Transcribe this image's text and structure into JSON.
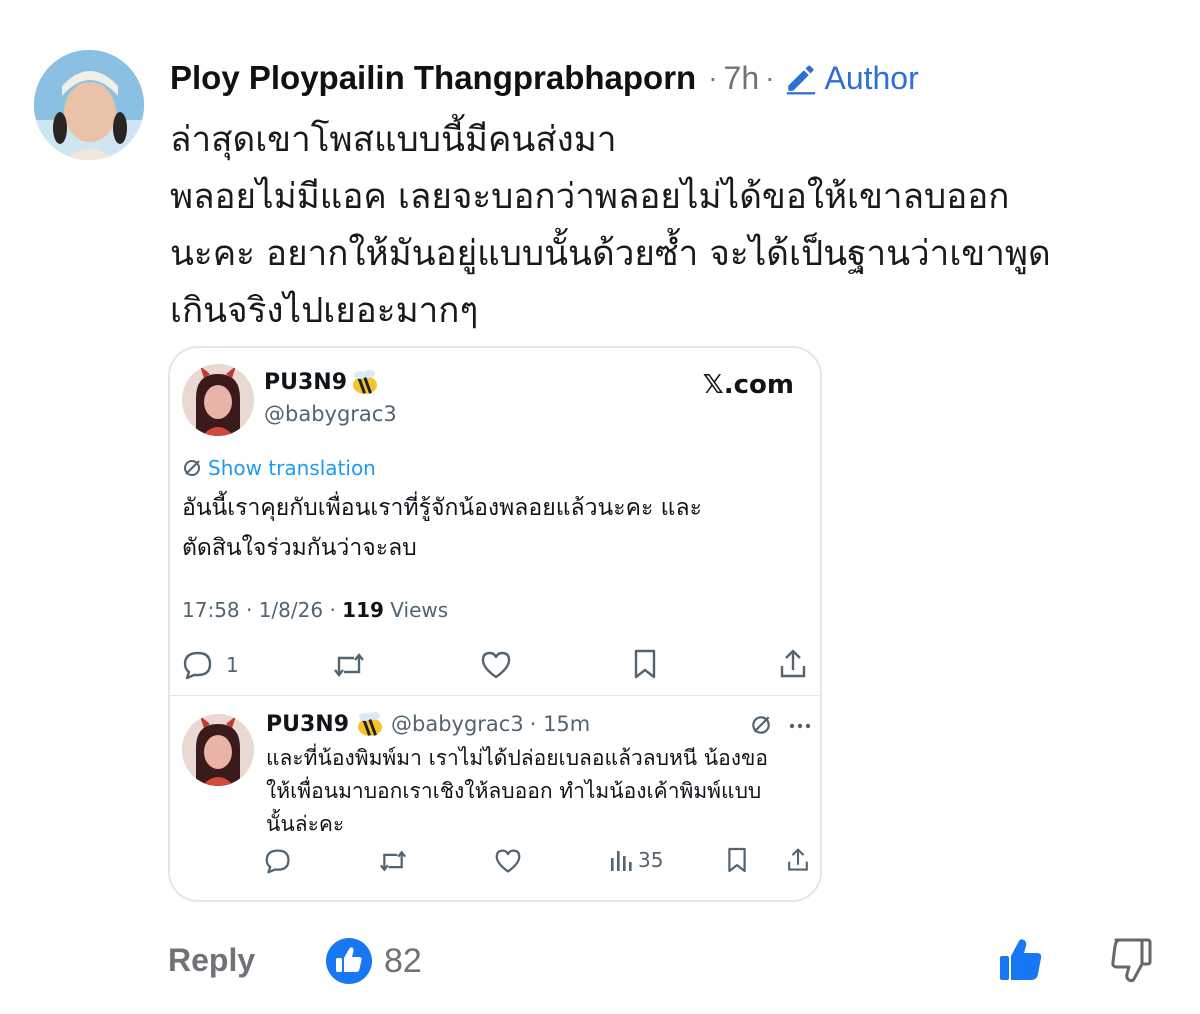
{
  "comment": {
    "author": "Ploy Ploypailin Thangprabhaporn",
    "time": "7h",
    "badge": "Author",
    "lines": [
      "ล่าสุดเขาโพสแบบนี้มีคนส่งมา",
      "พลอยไม่มีแอค เลยจะบอกว่าพลอยไม่ได้ขอให้เขาลบออก",
      "นะคะ อยากให้มันอยู่แบบนั้นด้วยซ้ำ จะได้เป็นฐานว่าเขาพูด",
      "เกินจริงไปเยอะมากๆ"
    ]
  },
  "tweet": {
    "name": "PU3N9",
    "handle": "@babygrac3",
    "source": "𝕏.com",
    "show_translation": "Show translation",
    "text_lines": [
      "อันนี้เราคุยกับเพื่อนเราที่รู้จักน้องพลอยแล้วนะคะ และ",
      "ตัดสินใจร่วมกันว่าจะลบ"
    ],
    "timestamp": "17:58 · 1/8/26 · ",
    "views_count": "119",
    "views_label": " Views",
    "reply_count": "1"
  },
  "reply_tweet": {
    "name": "PU3N9",
    "handle": "@babygrac3",
    "time": "· 15m",
    "text_lines": [
      "และที่น้องพิมพ์มา เราไม่ได้ปล่อยเบลอแล้วลบหนี น้องขอ",
      "ให้เพื่อนมาบอกเราเชิงให้ลบออก ทำไมน้องเค้าพิมพ์แบบ",
      "นั้นล่ะคะ"
    ],
    "views": "35"
  },
  "footer": {
    "reply_label": "Reply",
    "like_count": "82"
  },
  "colors": {
    "accent": "#1877f2",
    "badge_blue": "#2d6fd6",
    "muted": "#6f7377",
    "twitter_blue": "#1d9bf0"
  },
  "icons": [
    "pencil-icon",
    "bee-emoji-icon",
    "translate-icon",
    "reply-icon",
    "retweet-icon",
    "heart-icon",
    "bookmark-icon",
    "share-icon",
    "views-icon",
    "more-icon",
    "like-reaction-icon",
    "thumbs-up-icon",
    "thumbs-down-icon"
  ]
}
